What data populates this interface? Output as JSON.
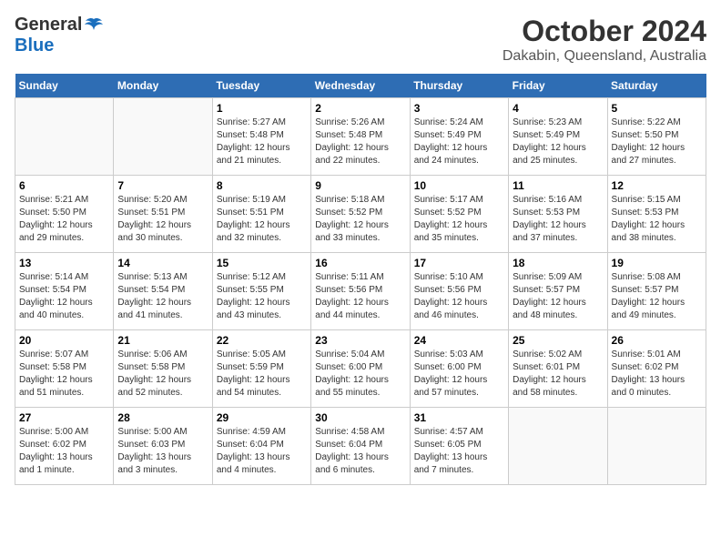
{
  "header": {
    "logo_general": "General",
    "logo_blue": "Blue",
    "month_title": "October 2024",
    "location": "Dakabin, Queensland, Australia"
  },
  "days_of_week": [
    "Sunday",
    "Monday",
    "Tuesday",
    "Wednesday",
    "Thursday",
    "Friday",
    "Saturday"
  ],
  "weeks": [
    [
      {
        "day": "",
        "info": ""
      },
      {
        "day": "",
        "info": ""
      },
      {
        "day": "1",
        "info": "Sunrise: 5:27 AM\nSunset: 5:48 PM\nDaylight: 12 hours and 21 minutes."
      },
      {
        "day": "2",
        "info": "Sunrise: 5:26 AM\nSunset: 5:48 PM\nDaylight: 12 hours and 22 minutes."
      },
      {
        "day": "3",
        "info": "Sunrise: 5:24 AM\nSunset: 5:49 PM\nDaylight: 12 hours and 24 minutes."
      },
      {
        "day": "4",
        "info": "Sunrise: 5:23 AM\nSunset: 5:49 PM\nDaylight: 12 hours and 25 minutes."
      },
      {
        "day": "5",
        "info": "Sunrise: 5:22 AM\nSunset: 5:50 PM\nDaylight: 12 hours and 27 minutes."
      }
    ],
    [
      {
        "day": "6",
        "info": "Sunrise: 5:21 AM\nSunset: 5:50 PM\nDaylight: 12 hours and 29 minutes."
      },
      {
        "day": "7",
        "info": "Sunrise: 5:20 AM\nSunset: 5:51 PM\nDaylight: 12 hours and 30 minutes."
      },
      {
        "day": "8",
        "info": "Sunrise: 5:19 AM\nSunset: 5:51 PM\nDaylight: 12 hours and 32 minutes."
      },
      {
        "day": "9",
        "info": "Sunrise: 5:18 AM\nSunset: 5:52 PM\nDaylight: 12 hours and 33 minutes."
      },
      {
        "day": "10",
        "info": "Sunrise: 5:17 AM\nSunset: 5:52 PM\nDaylight: 12 hours and 35 minutes."
      },
      {
        "day": "11",
        "info": "Sunrise: 5:16 AM\nSunset: 5:53 PM\nDaylight: 12 hours and 37 minutes."
      },
      {
        "day": "12",
        "info": "Sunrise: 5:15 AM\nSunset: 5:53 PM\nDaylight: 12 hours and 38 minutes."
      }
    ],
    [
      {
        "day": "13",
        "info": "Sunrise: 5:14 AM\nSunset: 5:54 PM\nDaylight: 12 hours and 40 minutes."
      },
      {
        "day": "14",
        "info": "Sunrise: 5:13 AM\nSunset: 5:54 PM\nDaylight: 12 hours and 41 minutes."
      },
      {
        "day": "15",
        "info": "Sunrise: 5:12 AM\nSunset: 5:55 PM\nDaylight: 12 hours and 43 minutes."
      },
      {
        "day": "16",
        "info": "Sunrise: 5:11 AM\nSunset: 5:56 PM\nDaylight: 12 hours and 44 minutes."
      },
      {
        "day": "17",
        "info": "Sunrise: 5:10 AM\nSunset: 5:56 PM\nDaylight: 12 hours and 46 minutes."
      },
      {
        "day": "18",
        "info": "Sunrise: 5:09 AM\nSunset: 5:57 PM\nDaylight: 12 hours and 48 minutes."
      },
      {
        "day": "19",
        "info": "Sunrise: 5:08 AM\nSunset: 5:57 PM\nDaylight: 12 hours and 49 minutes."
      }
    ],
    [
      {
        "day": "20",
        "info": "Sunrise: 5:07 AM\nSunset: 5:58 PM\nDaylight: 12 hours and 51 minutes."
      },
      {
        "day": "21",
        "info": "Sunrise: 5:06 AM\nSunset: 5:58 PM\nDaylight: 12 hours and 52 minutes."
      },
      {
        "day": "22",
        "info": "Sunrise: 5:05 AM\nSunset: 5:59 PM\nDaylight: 12 hours and 54 minutes."
      },
      {
        "day": "23",
        "info": "Sunrise: 5:04 AM\nSunset: 6:00 PM\nDaylight: 12 hours and 55 minutes."
      },
      {
        "day": "24",
        "info": "Sunrise: 5:03 AM\nSunset: 6:00 PM\nDaylight: 12 hours and 57 minutes."
      },
      {
        "day": "25",
        "info": "Sunrise: 5:02 AM\nSunset: 6:01 PM\nDaylight: 12 hours and 58 minutes."
      },
      {
        "day": "26",
        "info": "Sunrise: 5:01 AM\nSunset: 6:02 PM\nDaylight: 13 hours and 0 minutes."
      }
    ],
    [
      {
        "day": "27",
        "info": "Sunrise: 5:00 AM\nSunset: 6:02 PM\nDaylight: 13 hours and 1 minute."
      },
      {
        "day": "28",
        "info": "Sunrise: 5:00 AM\nSunset: 6:03 PM\nDaylight: 13 hours and 3 minutes."
      },
      {
        "day": "29",
        "info": "Sunrise: 4:59 AM\nSunset: 6:04 PM\nDaylight: 13 hours and 4 minutes."
      },
      {
        "day": "30",
        "info": "Sunrise: 4:58 AM\nSunset: 6:04 PM\nDaylight: 13 hours and 6 minutes."
      },
      {
        "day": "31",
        "info": "Sunrise: 4:57 AM\nSunset: 6:05 PM\nDaylight: 13 hours and 7 minutes."
      },
      {
        "day": "",
        "info": ""
      },
      {
        "day": "",
        "info": ""
      }
    ]
  ]
}
